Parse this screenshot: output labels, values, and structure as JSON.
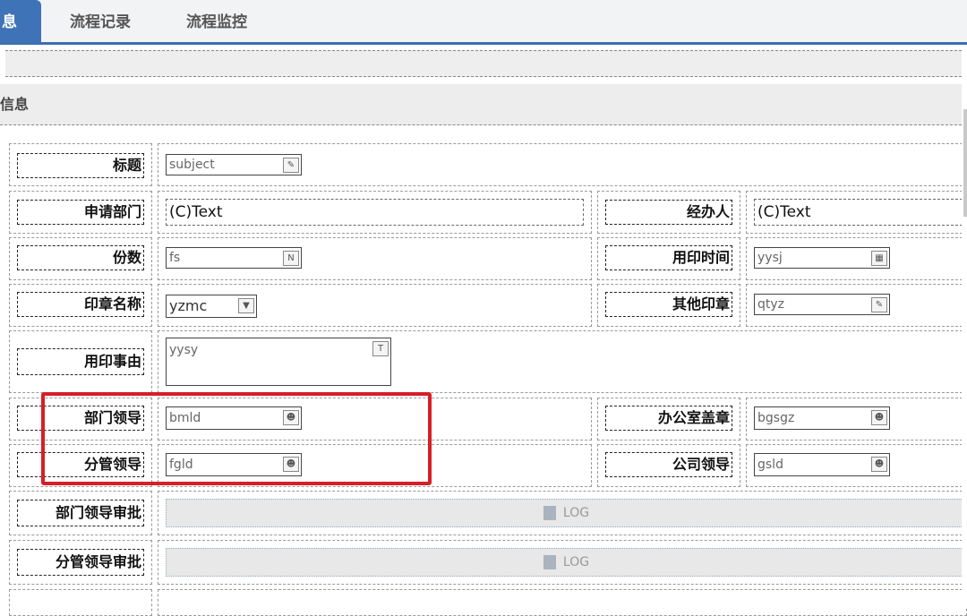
{
  "tabs": [
    {
      "label": "息"
    },
    {
      "label": "流程记录"
    },
    {
      "label": "流程监控"
    }
  ],
  "section": {
    "title": "信息"
  },
  "form": {
    "subject": {
      "label": "标题",
      "value": "subject"
    },
    "dept": {
      "label": "申请部门",
      "value": "(C)Text"
    },
    "handler": {
      "label": "经办人",
      "value": "(C)Text"
    },
    "copies": {
      "label": "份数",
      "value": "fs"
    },
    "use_time": {
      "label": "用印时间",
      "value": "yysj"
    },
    "seal_name": {
      "label": "印章名称",
      "value": "yzmc"
    },
    "other_seal": {
      "label": "其他印章",
      "value": "qtyz"
    },
    "reason": {
      "label": "用印事由",
      "value": "yysy"
    },
    "dept_leader": {
      "label": "部门领导",
      "value": "bmld"
    },
    "office_seal": {
      "label": "办公室盖章",
      "value": "bgsgz"
    },
    "branch_leader": {
      "label": "分管领导",
      "value": "fgld"
    },
    "company_leader": {
      "label": "公司领导",
      "value": "gsld"
    },
    "dept_approval": {
      "label": "部门领导审批",
      "value": "LOG"
    },
    "branch_approval": {
      "label": "分管领导审批",
      "value": "LOG"
    }
  },
  "icons": {
    "edit": "edit-icon",
    "number": "number-icon",
    "calendar": "calendar-icon",
    "dropdown": "chevron-down-icon",
    "textarea": "textarea-icon",
    "user": "user-icon",
    "log": "log-icon"
  },
  "colors": {
    "tab_active": "#3f73b8",
    "highlight": "#d61f26"
  }
}
